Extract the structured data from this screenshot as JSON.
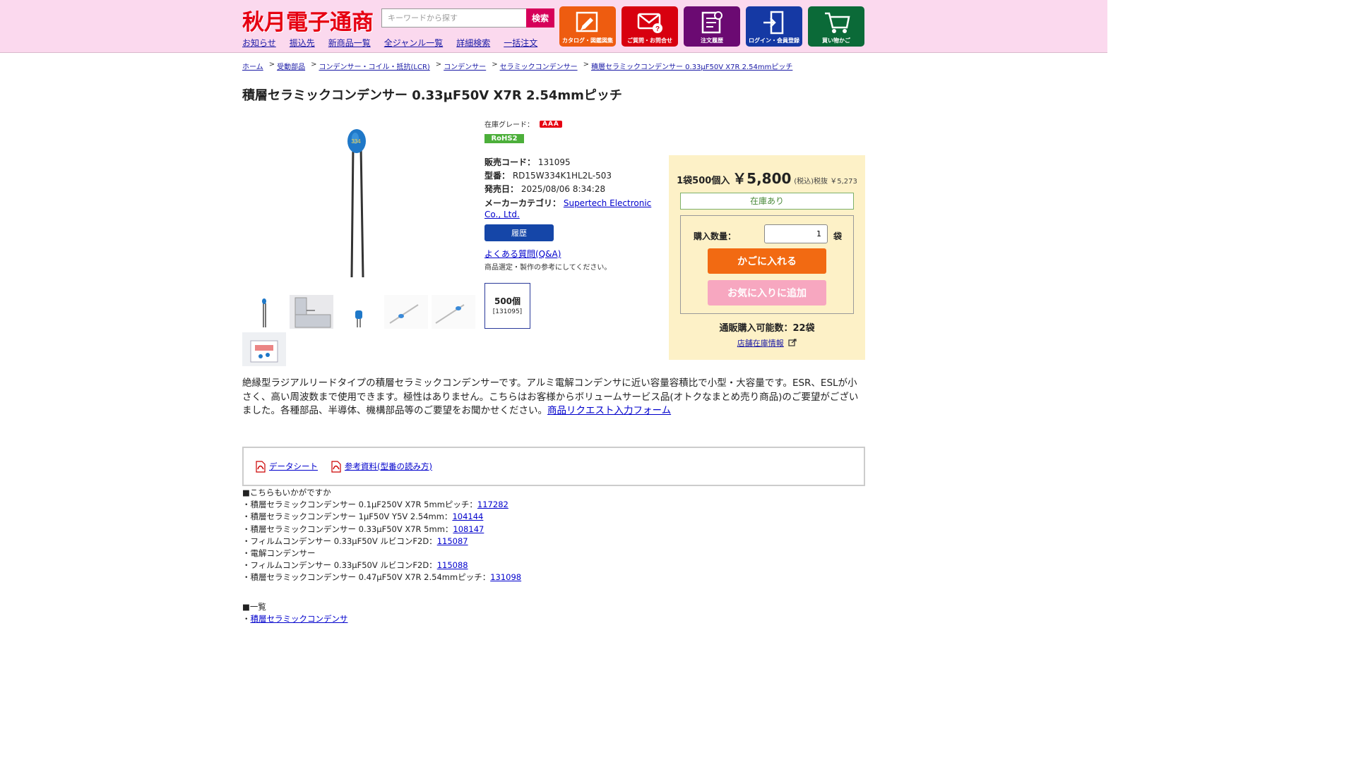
{
  "header": {
    "logo": "秋月電子通商",
    "search_placeholder": "キーワードから探す",
    "search_button": "検索",
    "nav": [
      "お知らせ",
      "振込先",
      "新商品一覧",
      "全ジャンル一覧",
      "詳細検索",
      "一括注文"
    ],
    "tiles": [
      {
        "label": "カタログ・図鑑図集",
        "color": "#ee5c10",
        "icon": "catalog-icon"
      },
      {
        "label": "ご質問・お問合せ",
        "color": "#d8000f",
        "icon": "mail-question-icon"
      },
      {
        "label": "注文履歴",
        "color": "#6b0a72",
        "icon": "order-history-icon"
      },
      {
        "label": "ログイン・会員登録",
        "color": "#1539a4",
        "icon": "login-icon"
      },
      {
        "label": "買い物かご",
        "color": "#0b6a38",
        "icon": "cart-icon"
      }
    ]
  },
  "breadcrumb": [
    "ホーム",
    "受動部品",
    "コンデンサー・コイル・抵抗(LCR)",
    "コンデンサー",
    "セラミックコンデンサー",
    "積層セラミックコンデンサー 0.33μF50V X7R 2.54mmピッチ"
  ],
  "product": {
    "title": "積層セラミックコンデンサー 0.33μF50V X7R 2.54mmピッチ",
    "grade_label": "在庫グレード：",
    "grade": "AAA",
    "rohs": "RoHS2",
    "code_label": "販売コード：",
    "code": "131095",
    "model_label": "型番：",
    "model": "RD15W334K1HL2L-503",
    "release_label": "発売日：",
    "release": "2025/08/06 8:34:28",
    "maker_label": "メーカーカテゴリ：",
    "maker": "Supertech Electronic Co., Ltd.",
    "history_button": "履歴",
    "faq": "よくある質問(Q&A)",
    "faq_note": "商品選定・製作の参考にしてください。",
    "variant_qty": "500個",
    "variant_code": "[131095]",
    "cap_marking": "334"
  },
  "buy": {
    "unit": "1袋500個入",
    "price": "￥5,800",
    "tax_note": "(税込)税抜 ￥5,273",
    "stock": "在庫あり",
    "qty_label": "購入数量：",
    "qty_value": "1",
    "qty_unit": "袋",
    "cart_button": "かごに入れる",
    "fav_button": "お気に入りに追加",
    "available": "通販購入可能数：22袋",
    "store_link": "店舗在庫情報"
  },
  "description": {
    "text": "絶縁型ラジアルリードタイプの積層セラミックコンデンサーです。アルミ電解コンデンサに近い容量容積比で小型・大容量です。ESR、ESLが小さく、高い周波数まで使用できます。極性はありません。こちらはお客様からボリュームサービス品(オトクなまとめ売り商品)のご要望がございました。各種部品、半導体、機構部品等のご要望をお聞かせください。",
    "link": "商品リクエスト入力フォーム"
  },
  "docs": [
    "データシート",
    "参考資料(型番の読み方)"
  ],
  "related": {
    "heading": "■こちらもいかがですか",
    "items": [
      {
        "text": "・積層セラミックコンデンサー 0.1μF250V X7R 5mmピッチ：",
        "code": "117282"
      },
      {
        "text": "・積層セラミックコンデンサー 1μF50V Y5V 2.54mm：",
        "code": "104144"
      },
      {
        "text": "・積層セラミックコンデンサー 0.33μF50V X7R 5mm：",
        "code": "108147"
      },
      {
        "text": "・フィルムコンデンサー 0.33μF50V ルビコンF2D：",
        "code": "115087"
      },
      {
        "text": "・電解コンデンサー",
        "code": ""
      },
      {
        "text": "・フィルムコンデンサー 0.33μF50V ルビコンF2D：",
        "code": "115088"
      },
      {
        "text": "・積層セラミックコンデンサー 0.47μF50V X7R 2.54mmピッチ：",
        "code": "131098"
      }
    ]
  },
  "list": {
    "heading": "■一覧",
    "item_prefix": "・",
    "item": "積層セラミックコンデンサ"
  }
}
